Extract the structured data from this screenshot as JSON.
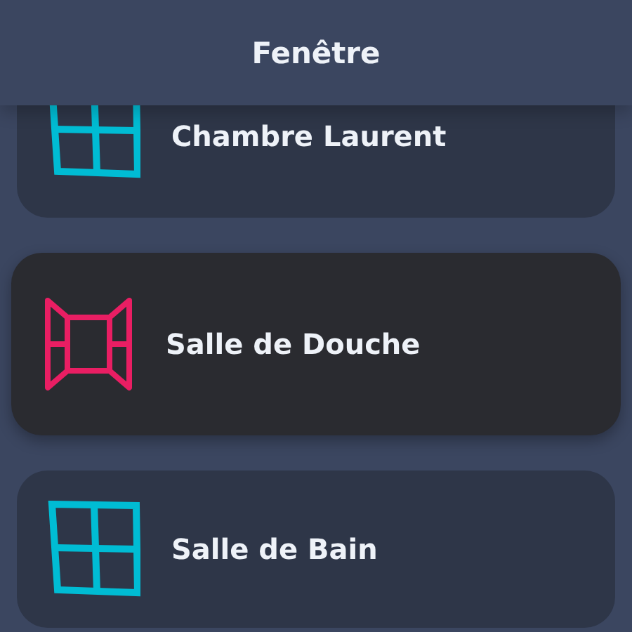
{
  "header": {
    "title": "Fenêtre"
  },
  "windows": [
    {
      "name": "Chambre Laurent",
      "open": false
    },
    {
      "name": "Salle de Douche",
      "open": true
    },
    {
      "name": "Salle de Bain",
      "open": false
    }
  ]
}
